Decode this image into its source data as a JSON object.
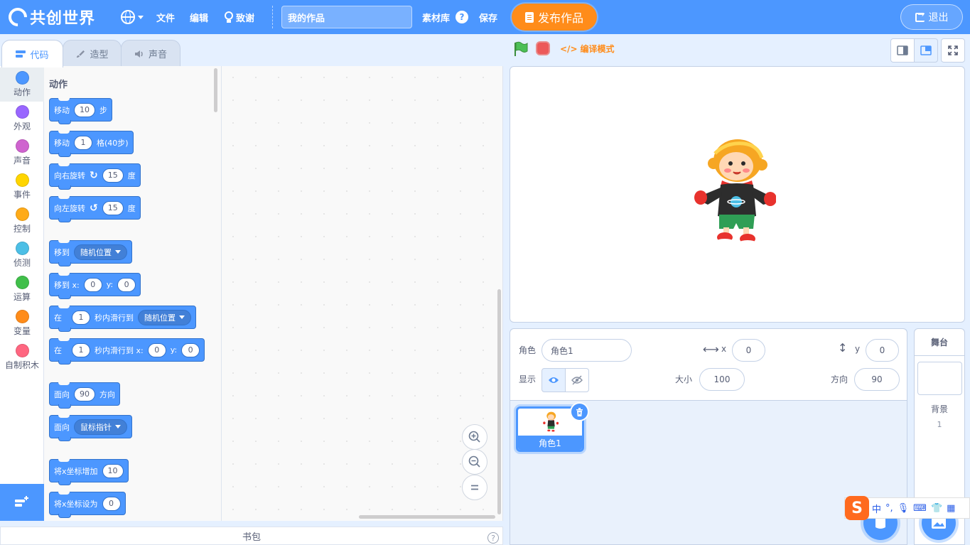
{
  "menubar": {
    "logo_text": "共创世界",
    "file": "文件",
    "edit": "编辑",
    "tutorial": "致谢",
    "project_title": "我的作品",
    "assets": "素材库",
    "help": "?",
    "save": "保存",
    "publish": "发布作品",
    "logout": "退出"
  },
  "tabs": {
    "code": "代码",
    "costumes": "造型",
    "sounds": "声音"
  },
  "categories": [
    {
      "label": "动作",
      "color": "#4c97ff"
    },
    {
      "label": "外观",
      "color": "#9966ff"
    },
    {
      "label": "声音",
      "color": "#cf63cf"
    },
    {
      "label": "事件",
      "color": "#ffd500"
    },
    {
      "label": "控制",
      "color": "#ffab19"
    },
    {
      "label": "侦测",
      "color": "#4cbfe6"
    },
    {
      "label": "运算",
      "color": "#40bf4a"
    },
    {
      "label": "变量",
      "color": "#ff8c1a"
    },
    {
      "label": "自制积木",
      "color": "#ff6680"
    }
  ],
  "flyout": {
    "title": "动作",
    "blocks": {
      "move": {
        "a": "移动",
        "v": "10",
        "b": "步"
      },
      "move_grid": {
        "a": "移动",
        "v": "1",
        "b": "格(40步)"
      },
      "turn_right": {
        "a": "向右旋转",
        "v": "15",
        "b": "度"
      },
      "turn_left": {
        "a": "向左旋转",
        "v": "15",
        "b": "度"
      },
      "goto": {
        "a": "移到",
        "dd": "随机位置"
      },
      "goto_xy": {
        "a": "移到 x:",
        "x": "0",
        "b": "y:",
        "y": "0"
      },
      "glide_to": {
        "a": "在",
        "v": "1",
        "b": "秒内滑行到",
        "dd": "随机位置"
      },
      "glide_xy": {
        "a": "在",
        "v": "1",
        "b": "秒内滑行到 x:",
        "x": "0",
        "c": "y:",
        "y": "0"
      },
      "point_dir": {
        "a": "面向",
        "v": "90",
        "b": "方向"
      },
      "point_towards": {
        "a": "面向",
        "dd": "鼠标指针"
      },
      "change_x": {
        "a": "将x坐标增加",
        "v": "10"
      },
      "set_x": {
        "a": "将x坐标设为",
        "v": "0"
      }
    }
  },
  "backpack": {
    "label": "书包",
    "help": "?"
  },
  "stage_header": {
    "compile_mode": "编译模式"
  },
  "sprite_info": {
    "sprite_label": "角色",
    "sprite_name": "角色1",
    "x_label": "x",
    "x_value": "0",
    "y_label": "y",
    "y_value": "0",
    "show_label": "显示",
    "size_label": "大小",
    "size_value": "100",
    "direction_label": "方向",
    "direction_value": "90"
  },
  "sprites": [
    {
      "name": "角色1"
    }
  ],
  "stage_panel": {
    "title": "舞台",
    "backdrops_label": "背景",
    "backdrops_count": "1"
  },
  "ime": {
    "logo": "S",
    "lang": "中"
  }
}
